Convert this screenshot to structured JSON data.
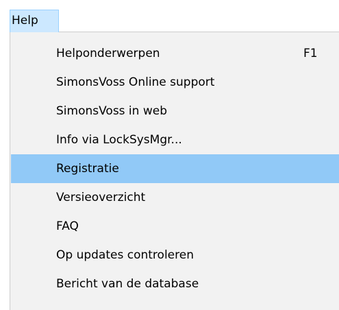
{
  "menubar": {
    "help_label": "Help"
  },
  "help_menu": {
    "items": [
      {
        "label": "Helponderwerpen",
        "shortcut": "F1"
      },
      {
        "label": "SimonsVoss Online support"
      },
      {
        "label": "SimonsVoss in web"
      },
      {
        "label": "Info via LockSysMgr..."
      },
      {
        "label": "Registratie",
        "highlighted": true
      },
      {
        "label": "Versieoverzicht"
      },
      {
        "label": "FAQ"
      },
      {
        "label": "Op updates controleren"
      },
      {
        "label": "Bericht van de database"
      }
    ]
  },
  "colors": {
    "menubar_active_bg": "#cce8ff",
    "menu_bg": "#f2f2f2",
    "highlight_bg": "#91c9f7"
  }
}
